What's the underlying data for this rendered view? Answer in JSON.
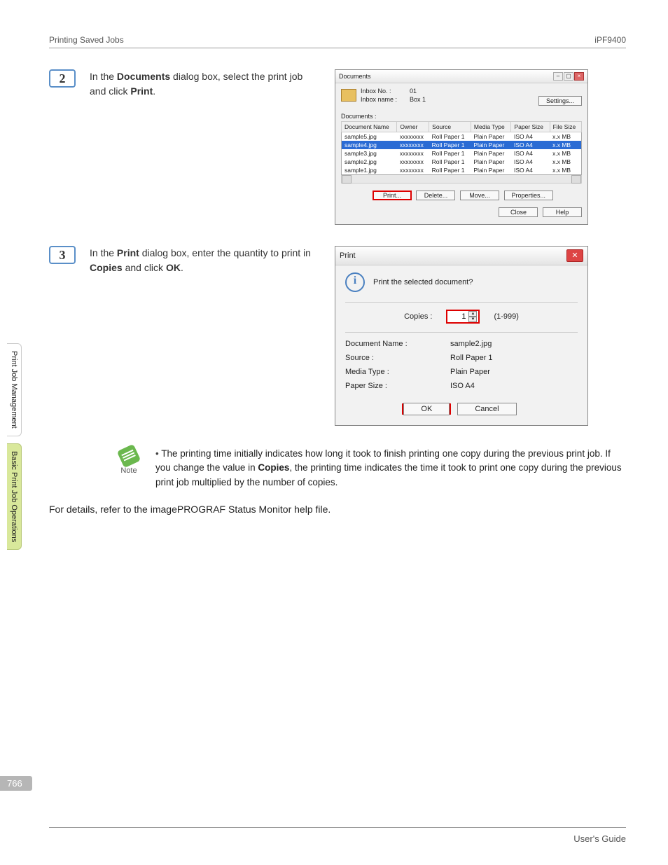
{
  "header": {
    "left": "Printing Saved Jobs",
    "right": "iPF9400"
  },
  "footer": {
    "right": "User's Guide"
  },
  "pageNumber": "766",
  "sideTabs": {
    "tab1": "Print Job Management",
    "tab2": "Basic Print Job Operations"
  },
  "step2": {
    "num": "2",
    "text_before": "In the ",
    "text_bold1": "Documents",
    "text_mid": " dialog box, select the print job and click ",
    "text_bold2": "Print",
    "text_after": "."
  },
  "step3": {
    "num": "3",
    "text_before": "In the ",
    "text_bold1": "Print",
    "text_mid": " dialog box, enter the quantity to print in ",
    "text_bold2": "Copies",
    "text_after": " and click ",
    "text_bold3": "OK",
    "text_end": "."
  },
  "note": {
    "label": "Note",
    "bullet_a": "The printing time initially indicates how long it took to finish printing one copy during the previous print job. If you change the value in ",
    "bullet_bold": "Copies",
    "bullet_b": ", the printing time indicates the time it took to print one copy during the previous print job multiplied by the number of copies."
  },
  "closing": "For details, refer to the imagePROGRAF Status Monitor help file.",
  "dlg1": {
    "title": "Documents",
    "inboxNoLabel": "Inbox No. :",
    "inboxNoVal": "01",
    "inboxNameLabel": "Inbox name :",
    "inboxNameVal": "Box 1",
    "settings": "Settings...",
    "listLabel": "Documents :",
    "cols": {
      "c0": "Document Name",
      "c1": "Owner",
      "c2": "Source",
      "c3": "Media Type",
      "c4": "Paper Size",
      "c5": "File Size"
    },
    "rows": [
      {
        "c0": "sample5.jpg",
        "c1": "xxxxxxxx",
        "c2": "Roll Paper 1",
        "c3": "Plain Paper",
        "c4": "ISO A4",
        "c5": "x.x MB"
      },
      {
        "c0": "sample4.jpg",
        "c1": "xxxxxxxx",
        "c2": "Roll Paper 1",
        "c3": "Plain Paper",
        "c4": "ISO A4",
        "c5": "x.x MB"
      },
      {
        "c0": "sample3.jpg",
        "c1": "xxxxxxxx",
        "c2": "Roll Paper 1",
        "c3": "Plain Paper",
        "c4": "ISO A4",
        "c5": "x.x MB"
      },
      {
        "c0": "sample2.jpg",
        "c1": "xxxxxxxx",
        "c2": "Roll Paper 1",
        "c3": "Plain Paper",
        "c4": "ISO A4",
        "c5": "x.x MB"
      },
      {
        "c0": "sample1.jpg",
        "c1": "xxxxxxxx",
        "c2": "Roll Paper 1",
        "c3": "Plain Paper",
        "c4": "ISO A4",
        "c5": "x.x MB"
      }
    ],
    "btnPrint": "Print...",
    "btnDelete": "Delete...",
    "btnMove": "Move...",
    "btnProps": "Properties...",
    "btnClose": "Close",
    "btnHelp": "Help"
  },
  "dlg2": {
    "title": "Print",
    "question": "Print the selected document?",
    "copiesLabel": "Copies :",
    "copiesVal": "1",
    "copiesRange": "(1-999)",
    "fields": {
      "docLabel": "Document Name :",
      "docVal": "sample2.jpg",
      "srcLabel": "Source :",
      "srcVal": "Roll Paper 1",
      "mediaLabel": "Media Type :",
      "mediaVal": "Plain Paper",
      "sizeLabel": "Paper Size :",
      "sizeVal": "ISO A4"
    },
    "ok": "OK",
    "cancel": "Cancel"
  }
}
